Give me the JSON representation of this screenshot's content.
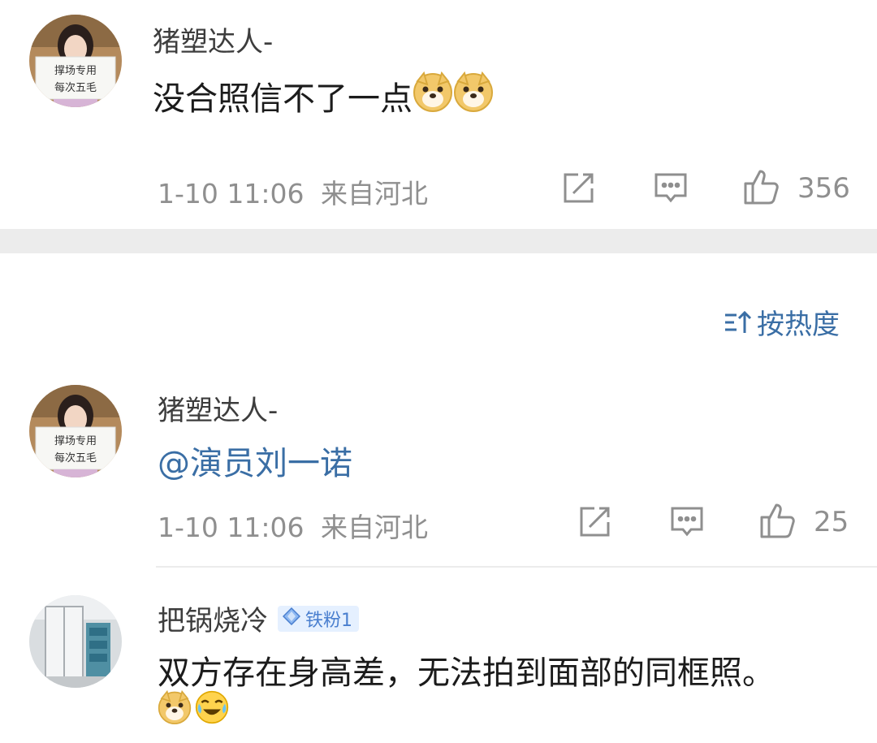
{
  "comments": [
    {
      "username": "猪塑达人-",
      "text": "没合照信不了一点",
      "emojis": [
        "doge-emoji",
        "doge-emoji"
      ],
      "timestamp": "1-10 11:06",
      "location": "来自河北",
      "likes": "356"
    }
  ],
  "sort": {
    "icon": "sort-icon",
    "label": "按热度"
  },
  "replies": [
    {
      "username": "猪塑达人-",
      "text": "@演员刘一诺",
      "timestamp": "1-10 11:06",
      "location": "来自河北",
      "likes": "25"
    },
    {
      "username": "把锅烧冷",
      "badge": "铁粉1",
      "text": "双方存在身高差，无法拍到面部的同框照。",
      "emojis": [
        "doge-emoji",
        "laugh-cry-emoji"
      ]
    }
  ],
  "colors": {
    "link": "#3a6ea5",
    "meta": "#8f8f8f",
    "divider": "#ececec",
    "badge_bg": "#e5f0ff"
  }
}
